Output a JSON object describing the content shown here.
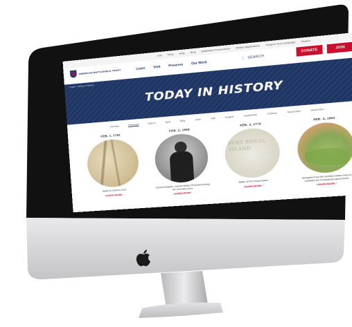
{
  "site": {
    "org_name": "AMERICAN BATTLEFIELD TRUST",
    "top_links": [
      "Join",
      "Shop",
      "Help",
      "Blog",
      "Battlefield Preservation",
      "Mobile Applications",
      "Support Our Campaign",
      "Search"
    ],
    "buttons": {
      "donate": "DONATE",
      "join": "JOIN"
    },
    "nav": [
      "Learn",
      "Visit",
      "Preserve",
      "Our Work"
    ],
    "search_label": "SEARCH",
    "breadcrumb": "Learn › Today in History",
    "hero_title": "TODAY IN HISTORY"
  },
  "months": {
    "items": [
      "January",
      "February",
      "March",
      "April",
      "May",
      "June",
      "July",
      "August",
      "September",
      "October",
      "November",
      "December"
    ],
    "active": "February"
  },
  "cards": [
    {
      "date": "FEB. 1, 1781",
      "caption": "Battle of Cowan's Ford",
      "more": "LEARN MORE ›"
    },
    {
      "date": "FEB. 2, 1865",
      "caption": "Second Brigade, Colonel Walker Promoted During the Civil War Union",
      "more": "LEARN MORE ›"
    },
    {
      "date": "FEB. 3, 1779",
      "caption": "Battle of Port Royal Island",
      "more": "LEARN MORE ›"
    },
    {
      "date": "FEB. 4, 1861",
      "caption": "Delegates from the seceded states meet to establish the Confederate government",
      "more": "LEARN MORE ›"
    }
  ],
  "map_text": "PORT ROYAL ISLAND",
  "colors": {
    "navy": "#1e3566",
    "red": "#c8102e",
    "bezel": "#111111",
    "aluminum": "#d8d8da"
  }
}
